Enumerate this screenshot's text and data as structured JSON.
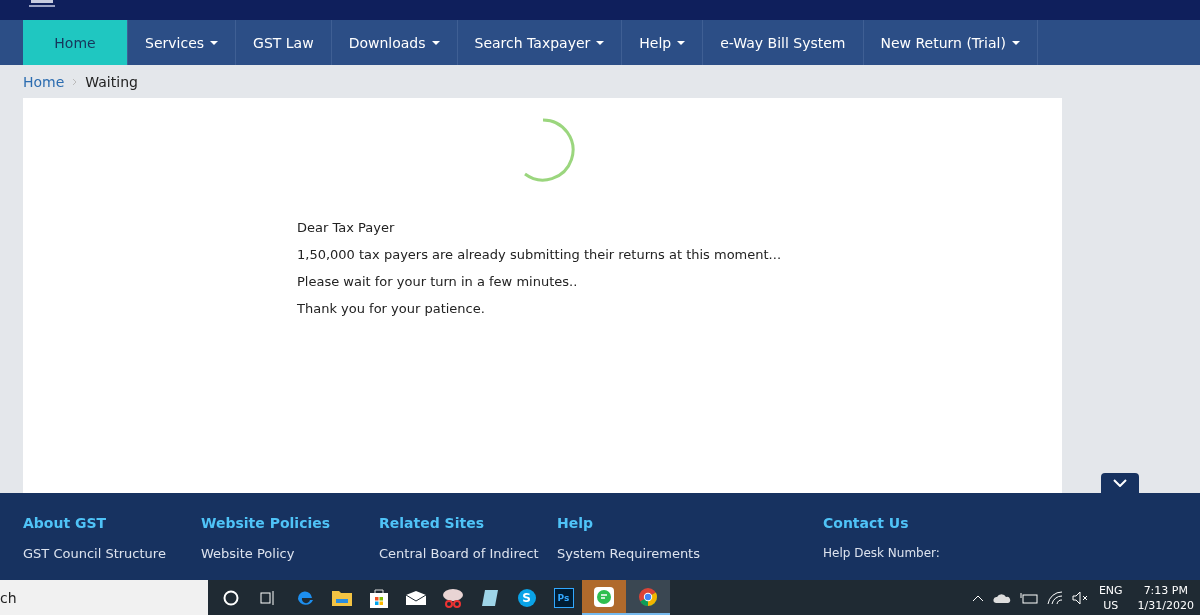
{
  "nav": [
    {
      "label": "Home",
      "dropdown": false,
      "selected": true
    },
    {
      "label": "Services",
      "dropdown": true,
      "selected": false
    },
    {
      "label": "GST Law",
      "dropdown": false,
      "selected": false
    },
    {
      "label": "Downloads",
      "dropdown": true,
      "selected": false
    },
    {
      "label": "Search Taxpayer",
      "dropdown": true,
      "selected": false
    },
    {
      "label": "Help",
      "dropdown": true,
      "selected": false
    },
    {
      "label": "e-Way Bill System",
      "dropdown": false,
      "selected": false
    },
    {
      "label": "New Return (Trial)",
      "dropdown": true,
      "selected": false
    }
  ],
  "breadcrumb": [
    {
      "label": "Home",
      "kind": "link"
    },
    {
      "label": "Waiting",
      "kind": "current"
    }
  ],
  "message": [
    "Dear Tax Payer",
    "1,50,000 tax payers are already submitting their returns at this moment...",
    "Please wait for your turn in a few minutes..",
    "Thank you for your patience."
  ],
  "footer": [
    {
      "heading": "About GST",
      "links": [
        "GST Council Structure"
      ]
    },
    {
      "heading": "Website Policies",
      "links": [
        "Website Policy"
      ]
    },
    {
      "heading": "Related Sites",
      "links": [
        "Central Board of Indirect"
      ]
    },
    {
      "heading": "Help",
      "links": [
        "System Requirements"
      ]
    },
    {
      "heading": "Contact Us",
      "links": [
        "Help Desk Number:"
      ]
    }
  ],
  "taskbar": {
    "search": {
      "value": "ch"
    },
    "apps": [
      {
        "kind": "cortana",
        "active": false
      },
      {
        "kind": "taskview",
        "active": false
      },
      {
        "kind": "edge",
        "active": false
      },
      {
        "kind": "folder",
        "active": false
      },
      {
        "kind": "store",
        "active": false
      },
      {
        "kind": "mail",
        "active": false
      },
      {
        "kind": "snip",
        "active": false
      },
      {
        "kind": "notes",
        "active": false
      },
      {
        "kind": "skype",
        "label": "S",
        "active": false
      },
      {
        "kind": "ps",
        "label": "Ps",
        "active": false
      },
      {
        "kind": "chat",
        "active": true
      },
      {
        "kind": "chrome",
        "active": true
      }
    ],
    "language": [
      "ENG",
      "US"
    ],
    "time": "7:13 PM",
    "date": "1/31/2020"
  }
}
